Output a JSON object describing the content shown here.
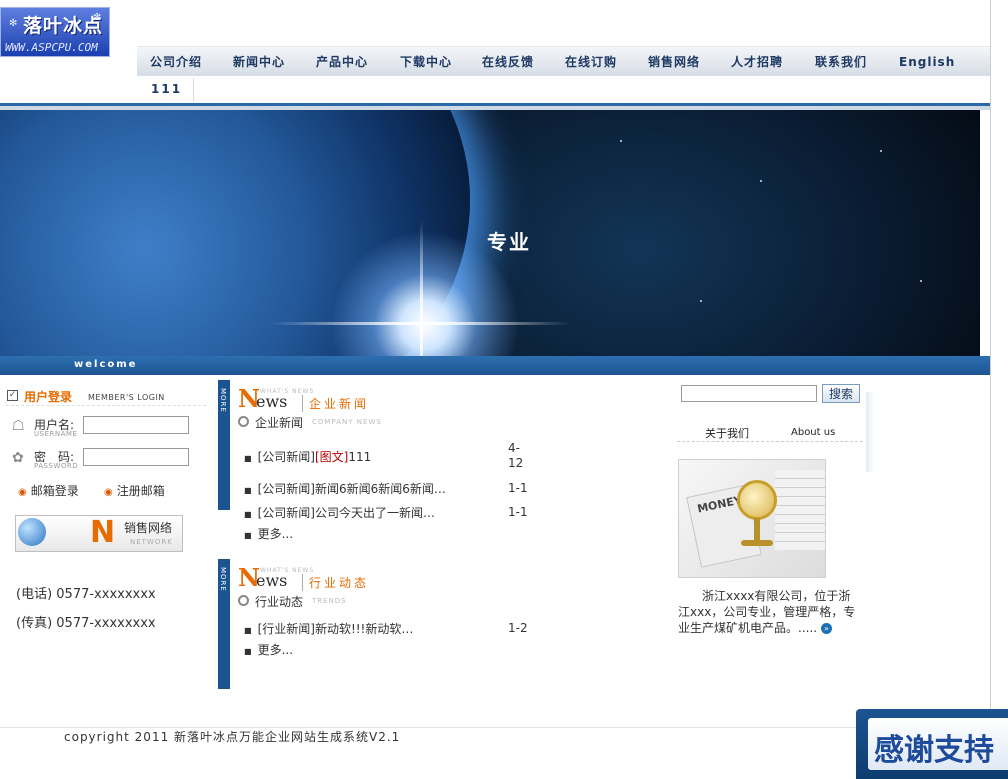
{
  "logo": {
    "cn": "落叶冰点",
    "en": "WWW.ASPCPU.COM"
  },
  "nav": {
    "items": [
      "公司介绍",
      "新闻中心",
      "产品中心",
      "下载中心",
      "在线反馈",
      "在线订购",
      "销售网络",
      "人才招聘",
      "联系我们",
      "English"
    ],
    "sub_item": "111"
  },
  "banner": {
    "text": "专业"
  },
  "welcome": "welcome",
  "login": {
    "title": "用户登录",
    "subtitle": "MEMBER'S LOGIN",
    "username_label": "用户名:",
    "username_sub": "USERNAME",
    "password_label": "密　码:",
    "password_sub": "PASSWORD",
    "mail_login": "邮箱登录",
    "register_mail": "注册邮箱"
  },
  "sales": {
    "cn": "销售网络",
    "en": "NETWORK"
  },
  "contact": {
    "phone": "(电话) 0577-xxxxxxxx",
    "fax": "(传真) 0577-xxxxxxxx"
  },
  "news_section": {
    "more": "MORE",
    "news_word": "ews",
    "whats_new": "WHAT'S NEWS",
    "title": "企业新闻",
    "sub_title": "企业新闻",
    "sub_en": "COMPANY NEWS",
    "items": [
      {
        "prefix": "[公司新闻]",
        "tag": "[图文]",
        "text": "111",
        "date": "4-12"
      },
      {
        "prefix": "[公司新闻]",
        "tag": "",
        "text": "新闻6新闻6新闻6新闻…",
        "date": "1-1"
      },
      {
        "prefix": "[公司新闻]",
        "tag": "",
        "text": "公司今天出了一新闻…",
        "date": "1-1"
      }
    ],
    "more_link": "更多..."
  },
  "trend_section": {
    "more": "MORE",
    "news_word": "ews",
    "whats_new": "WHAT'S NEWS",
    "title": "行业动态",
    "sub_title": "行业动态",
    "sub_en": "TRENDS",
    "items": [
      {
        "prefix": "[行业新闻]",
        "text": "新动软!!!新动软…",
        "date": "1-2"
      }
    ],
    "more_link": "更多..."
  },
  "search": {
    "button": "搜索",
    "value": ""
  },
  "about": {
    "tab_cn": "关于我们",
    "tab_en": "About us",
    "image_text": "MONEY",
    "text": "　　浙江xxxx有限公司，位于浙江xxx，公司专业，管理严格，专业生产煤矿机电产品。....."
  },
  "footer": {
    "copyright": "copyright 2011 新落叶冰点万能企业网站生成系统V2.1"
  },
  "thanks": {
    "text": "感谢支持"
  },
  "colors": {
    "accent": "#e86b00",
    "primary_blue": "#1c5492",
    "nav_text": "#1e3a63"
  }
}
